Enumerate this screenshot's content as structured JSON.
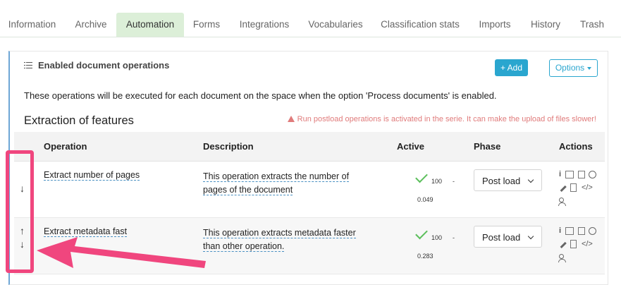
{
  "tabs": [
    {
      "label": "Information",
      "active": false
    },
    {
      "label": "Archive",
      "active": false
    },
    {
      "label": "Automation",
      "active": true
    },
    {
      "label": "Forms",
      "active": false
    },
    {
      "label": "Integrations",
      "active": false
    },
    {
      "label": "Vocabularies",
      "active": false
    },
    {
      "label": "Classification stats",
      "active": false
    },
    {
      "label": "Imports",
      "active": false
    },
    {
      "label": "History",
      "active": false
    },
    {
      "label": "Trash",
      "active": false
    }
  ],
  "card": {
    "title": "Enabled document operations",
    "add_label": "+ Add",
    "options_label": "Options",
    "description": "These operations will be executed for each document on the space when the option 'Process documents' is enabled.",
    "section_title": "Extraction of features",
    "warning": "Run postload operations is activated in the serie. It can make the upload of files slower!"
  },
  "table": {
    "headers": [
      "Operation",
      "Description",
      "Active",
      "Phase",
      "Actions"
    ],
    "rows": [
      {
        "operation": "Extract number of pages",
        "description": "This operation extracts the number of pages of the document",
        "score": "100",
        "dash": "-",
        "time": "0.049",
        "phase": "Post load",
        "arrows": [
          "↓"
        ]
      },
      {
        "operation": "Extract metadata fast",
        "description": "This operation extracts metadata faster than other operation.",
        "score": "100",
        "dash": "-",
        "time": "0.283",
        "phase": "Post load",
        "arrows": [
          "↑",
          "↓"
        ]
      }
    ]
  },
  "colors": {
    "accent": "#2aa6cf",
    "active_tab_bg": "#dcefd8",
    "warning": "#e07b7b",
    "check": "#5cbf5c",
    "annotation": "#f0467e"
  },
  "icons": [
    "list-icon",
    "info-icon",
    "keyboard-icon",
    "copy-icon",
    "power-icon",
    "pencil-icon",
    "document-icon",
    "code-icon",
    "user-settings-icon",
    "arrow-up-icon",
    "arrow-down-icon",
    "checkmark-icon",
    "chevron-down-icon",
    "warning-icon"
  ]
}
